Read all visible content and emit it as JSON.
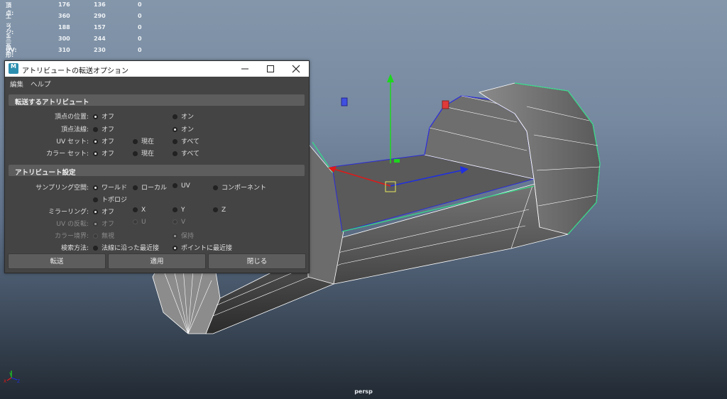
{
  "viewport": {
    "camera_label": "persp",
    "hud_stats": [
      {
        "label": "頂点:",
        "v1": "176",
        "v2": "136",
        "v3": "0"
      },
      {
        "label": "エッジ:",
        "v1": "360",
        "v2": "290",
        "v3": "0"
      },
      {
        "label": "フェース:",
        "v1": "188",
        "v2": "157",
        "v3": "0"
      },
      {
        "label": "三角形:",
        "v1": "300",
        "v2": "244",
        "v3": "0"
      },
      {
        "label": "UV:",
        "v1": "310",
        "v2": "230",
        "v3": "0"
      }
    ],
    "axis_letters": {
      "x": "X",
      "y": "Y",
      "z": "Z"
    },
    "colors": {
      "x_axis": "#e01818",
      "y_axis": "#1ed61e",
      "z_axis": "#1f2fe0",
      "highlight": "#33dd88"
    }
  },
  "dialog": {
    "icon_letter": "M",
    "title": "アトリビュートの転送オプション",
    "menus": [
      "編集",
      "ヘルプ"
    ],
    "sections": {
      "transfer": "転送するアトリビュート",
      "settings": "アトリビュート設定"
    },
    "rows": {
      "vertex_position": {
        "label": "頂点の位置:",
        "options": [
          "オフ",
          "オン"
        ]
      },
      "vertex_normal": {
        "label": "頂点法線:",
        "options": [
          "オフ",
          "オン"
        ]
      },
      "uv_set": {
        "label": "UV セット:",
        "options": [
          "オフ",
          "現在",
          "すべて"
        ]
      },
      "color_set": {
        "label": "カラー セット:",
        "options": [
          "オフ",
          "現在",
          "すべて"
        ]
      },
      "sampling_space": {
        "label": "サンプリング空間:",
        "options": [
          "ワールド",
          "ローカル",
          "UV",
          "コンポーネント",
          "トポロジ"
        ]
      },
      "mirroring": {
        "label": "ミラーリング:",
        "options": [
          "オフ",
          "X",
          "Y",
          "Z"
        ]
      },
      "flip_uv": {
        "label": "UV の反転:",
        "options": [
          "オフ",
          "U",
          "V"
        ]
      },
      "color_borders": {
        "label": "カラー境界:",
        "options": [
          "無視",
          "保持"
        ]
      },
      "search_method": {
        "label": "検索方法:",
        "options": [
          "法線に沿った最近接",
          "ポイントに最近接"
        ]
      }
    },
    "buttons": {
      "transfer": "転送",
      "apply": "適用",
      "close": "閉じる"
    }
  }
}
